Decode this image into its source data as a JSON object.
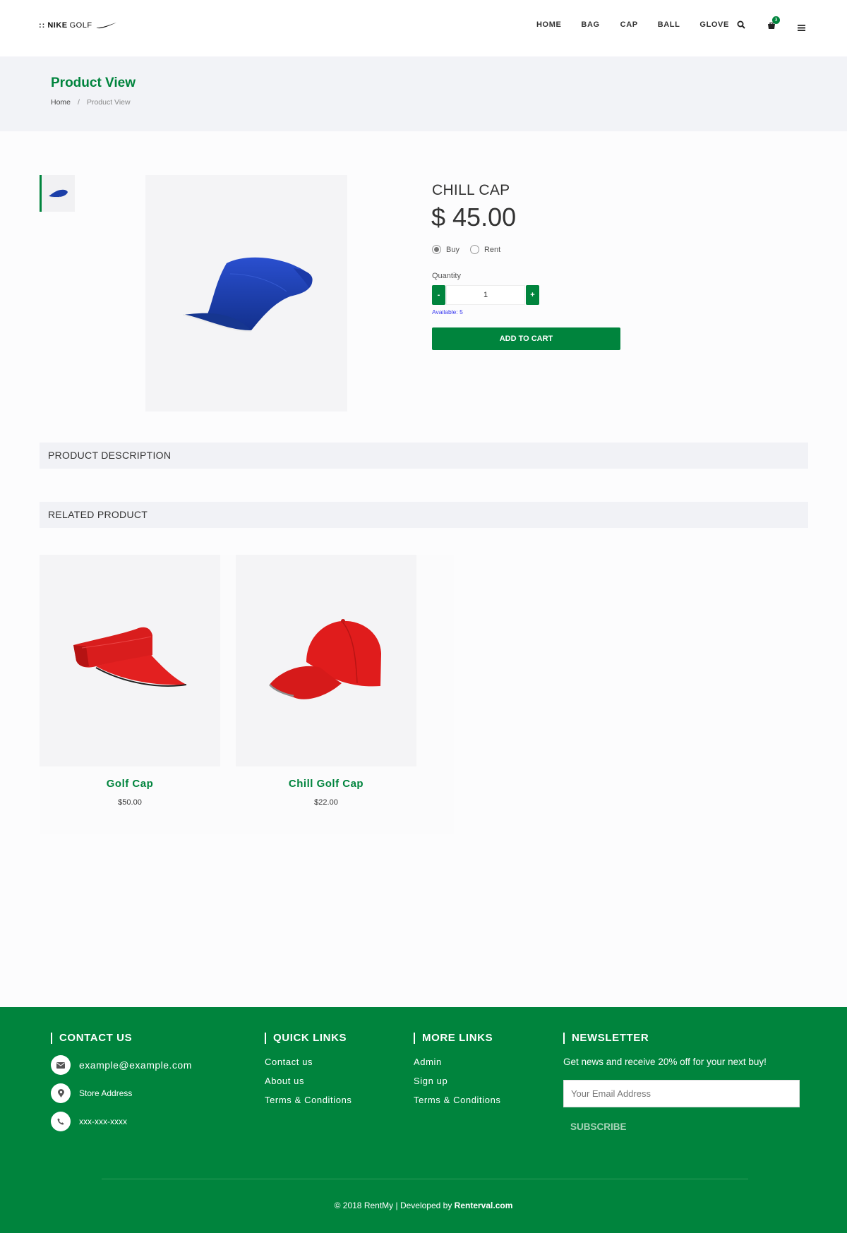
{
  "header": {
    "logo": {
      "dots": "::",
      "brand_bold": "NIKE",
      "brand_light": "GOLF"
    },
    "nav": [
      "HOME",
      "BAG",
      "CAP",
      "BALL",
      "GLOVE"
    ],
    "cart_count": "3",
    "icons": [
      "search-icon",
      "cart-icon",
      "menu-icon"
    ]
  },
  "page_header": {
    "title": "Product View",
    "breadcrumb": {
      "home": "Home",
      "separator": "/",
      "current": "Product View"
    }
  },
  "product": {
    "name": "CHILL CAP",
    "price": "$ 45.00",
    "options": {
      "buy": "Buy",
      "rent": "Rent",
      "selected": "buy"
    },
    "quantity_label": "Quantity",
    "quantity": "1",
    "minus": "-",
    "plus": "+",
    "available": "Available: 5",
    "add_to_cart": "ADD TO CART"
  },
  "sections": {
    "description": "PRODUCT DESCRIPTION",
    "related": "RELATED PRODUCT"
  },
  "related_products": [
    {
      "name": "Golf Cap",
      "price": "$50.00"
    },
    {
      "name": "Chill Golf Cap",
      "price": "$22.00"
    }
  ],
  "footer": {
    "contact": {
      "heading": "CONTACT US",
      "email": "example@example.com",
      "address": "Store Address",
      "phone": "xxx-xxx-xxxx"
    },
    "quick_links": {
      "heading": "QUICK LINKS",
      "items": [
        "Contact us",
        "About us",
        "Terms & Conditions"
      ]
    },
    "more_links": {
      "heading": "MORE LINKS",
      "items": [
        "Admin",
        "Sign up",
        "Terms & Conditions"
      ]
    },
    "newsletter": {
      "heading": "NEWSLETTER",
      "text": "Get news and receive 20% off for your next buy!",
      "placeholder": "Your Email Address",
      "button": "SUBSCRIBE"
    },
    "copyright_prefix": "© 2018 RentMy | Developed by ",
    "copyright_brand": "Renterval.com"
  },
  "colors": {
    "brand_green": "#00843d",
    "page_header_bg": "#f2f3f7",
    "available_text": "#3a3af0"
  }
}
